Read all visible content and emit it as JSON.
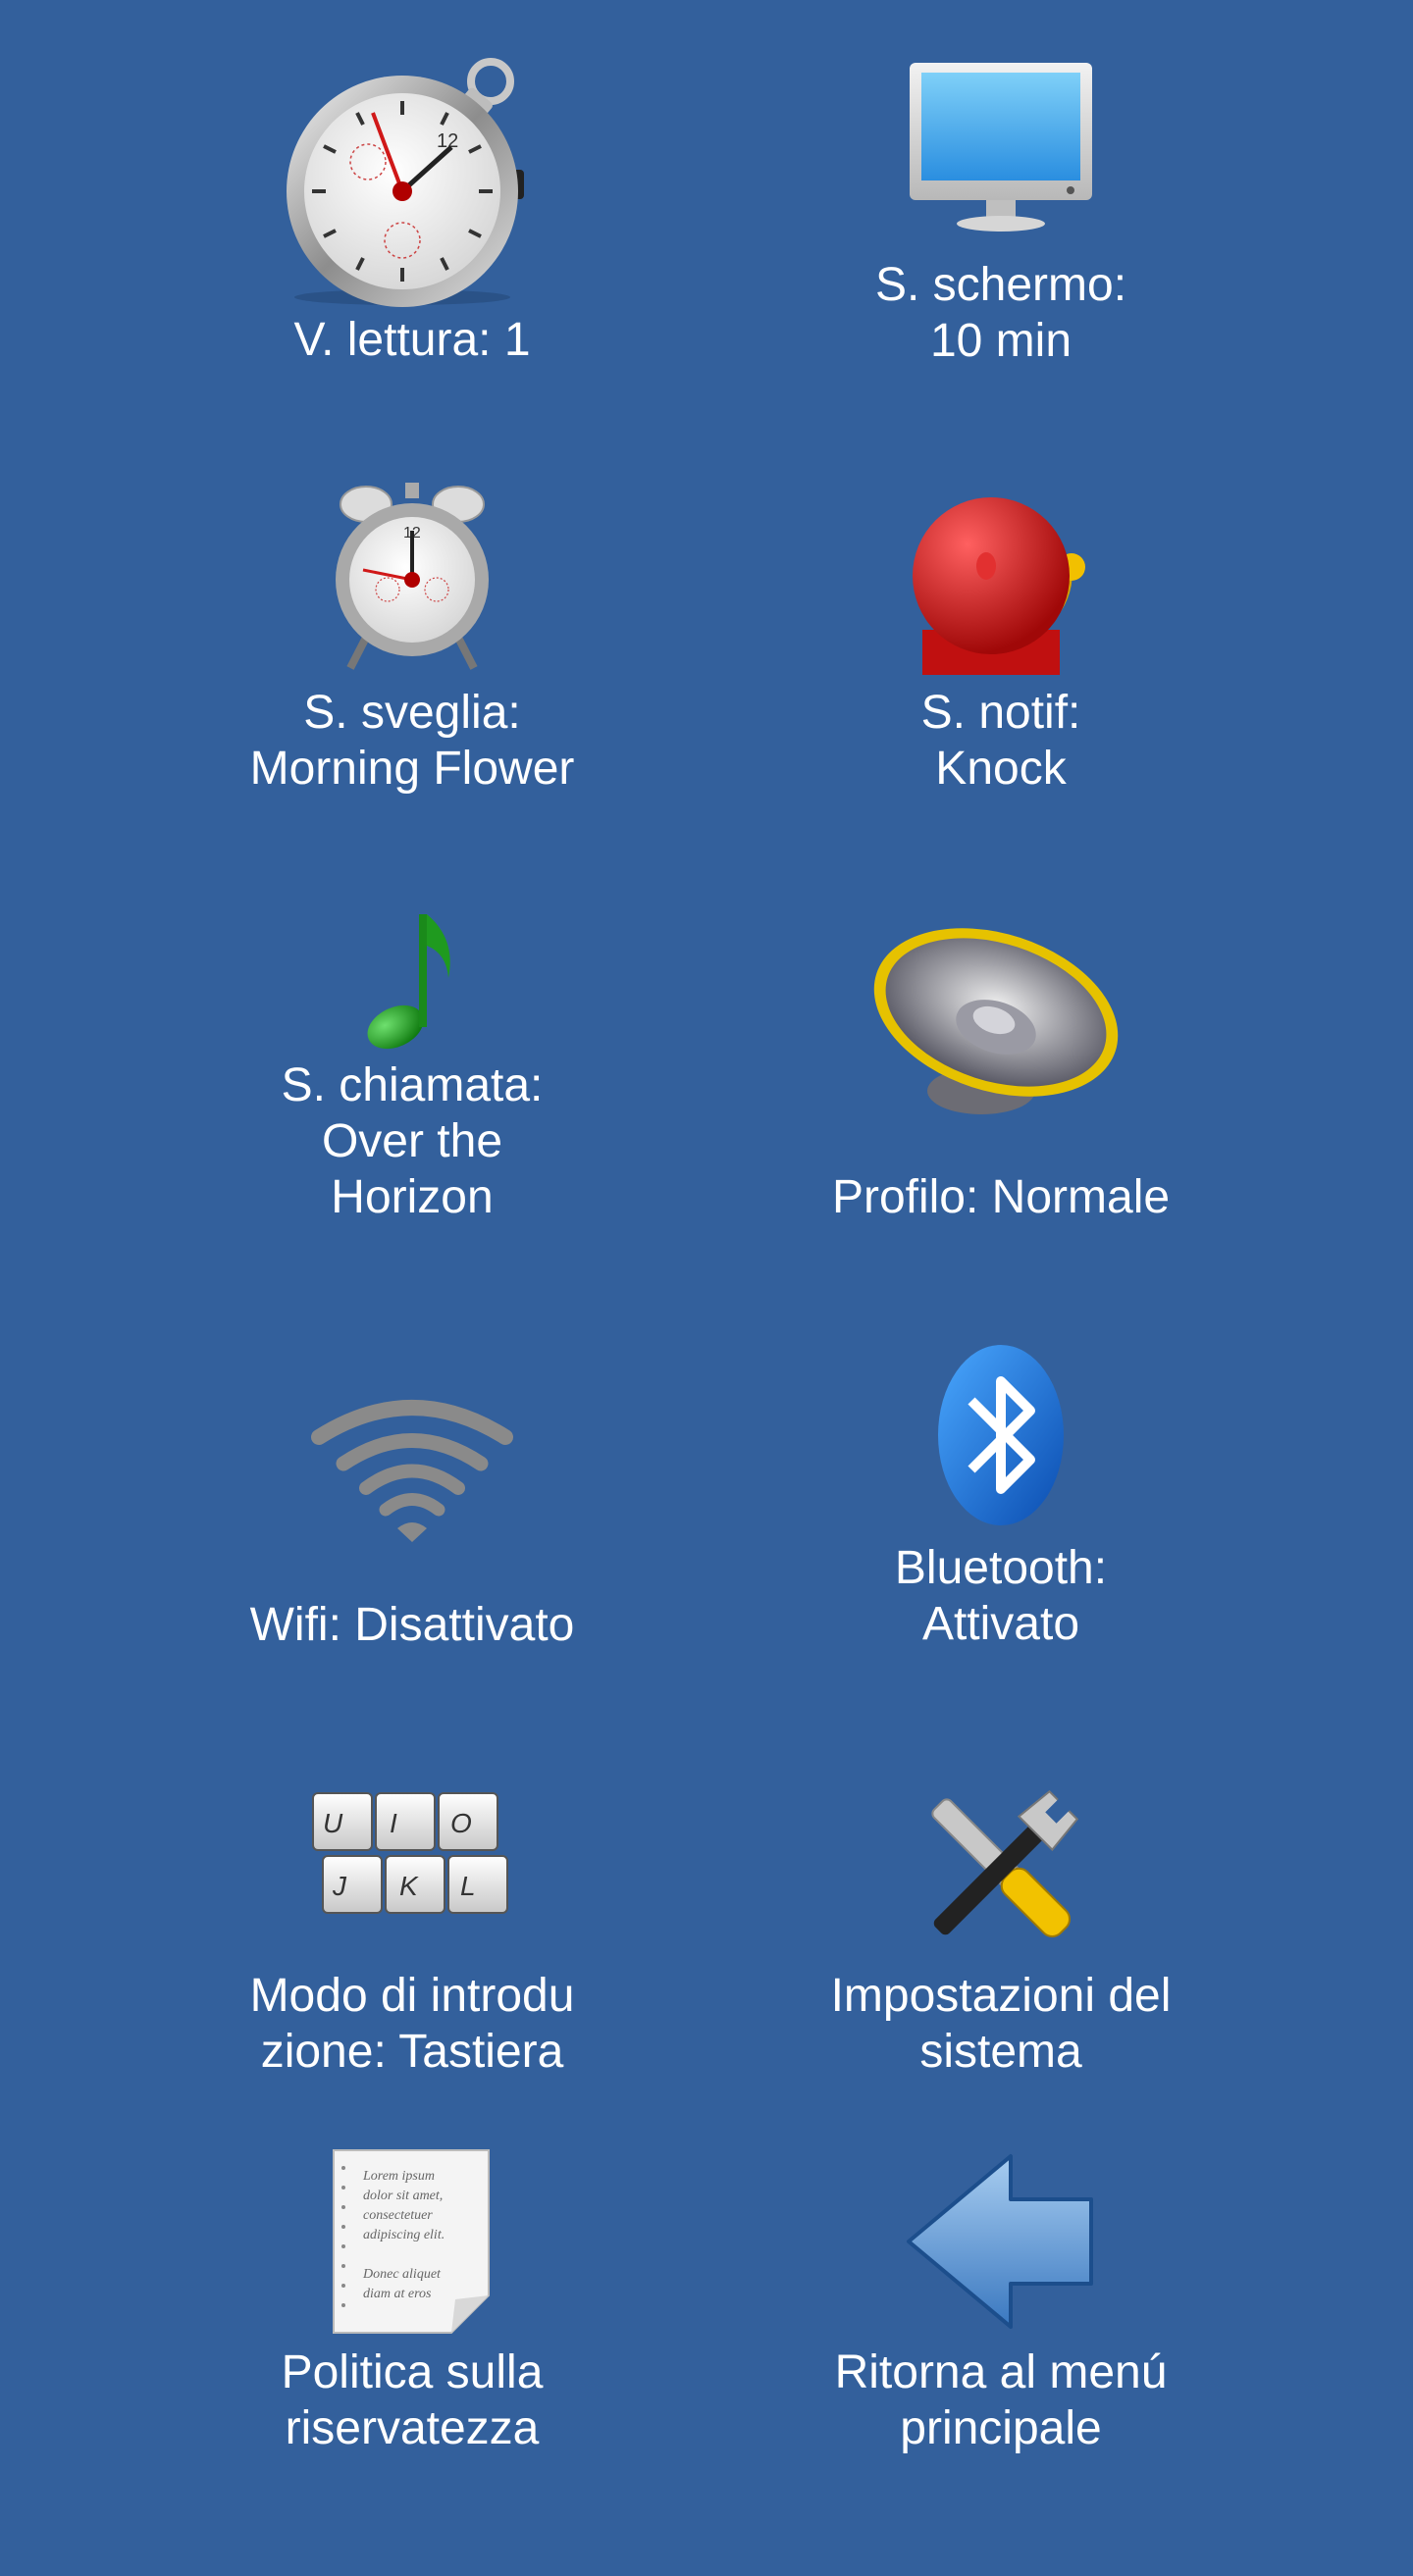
{
  "colors": {
    "background": "#33609c",
    "text": "#ffffff"
  },
  "items": [
    {
      "label": "V. lettura: 1",
      "icon": "stopwatch-icon"
    },
    {
      "label": "S. schermo:\n10 min",
      "icon": "monitor-icon"
    },
    {
      "label": "S. sveglia:\nMorning Flower",
      "icon": "alarm-clock-icon"
    },
    {
      "label": "S. notif:\nKnock",
      "icon": "bell-icon"
    },
    {
      "label": "S. chiamata:\nOver the\nHorizon",
      "icon": "music-note-icon"
    },
    {
      "label": "Profilo: Normale",
      "icon": "speaker-icon"
    },
    {
      "label": "Wifi: Disattivato",
      "icon": "wifi-icon"
    },
    {
      "label": "Bluetooth:\nAttivato",
      "icon": "bluetooth-icon"
    },
    {
      "label": "Modo di introdu\nzione: Tastiera",
      "icon": "keyboard-icon"
    },
    {
      "label": "Impostazioni del\nsistema",
      "icon": "tools-icon"
    },
    {
      "label": "Politica sulla\nriservatezza",
      "icon": "document-icon"
    },
    {
      "label": "Ritorna al menú\nprincipale",
      "icon": "back-arrow-icon"
    }
  ],
  "keyboard_keys": [
    "U",
    "I",
    "O",
    "J",
    "K",
    "L"
  ],
  "document_text": [
    "Lorem ipsum",
    "dolor sit amet,",
    "consectetuer",
    "adipiscing elit.",
    "Donec aliquet",
    "diam at eros"
  ]
}
